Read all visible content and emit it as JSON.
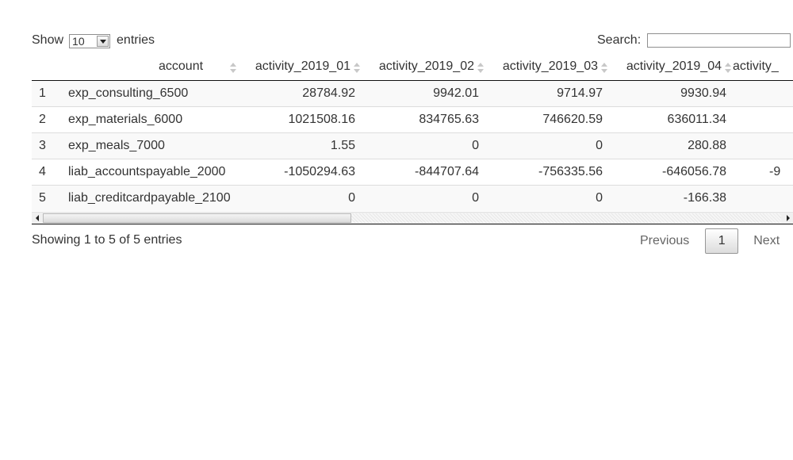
{
  "length_control": {
    "prefix": "Show",
    "selected": "10",
    "suffix": "entries"
  },
  "search": {
    "label": "Search:",
    "value": ""
  },
  "table": {
    "headers": {
      "account": "account",
      "col1": "activity_2019_01",
      "col2": "activity_2019_02",
      "col3": "activity_2019_03",
      "col4": "activity_2019_04",
      "col5": "activity_"
    },
    "rows": [
      {
        "idx": "1",
        "account": "exp_consulting_6500",
        "v1": "28784.92",
        "v2": "9942.01",
        "v3": "9714.97",
        "v4": "9930.94",
        "v5": ""
      },
      {
        "idx": "2",
        "account": "exp_materials_6000",
        "v1": "1021508.16",
        "v2": "834765.63",
        "v3": "746620.59",
        "v4": "636011.34",
        "v5": ""
      },
      {
        "idx": "3",
        "account": "exp_meals_7000",
        "v1": "1.55",
        "v2": "0",
        "v3": "0",
        "v4": "280.88",
        "v5": ""
      },
      {
        "idx": "4",
        "account": "liab_accountspayable_2000",
        "v1": "-1050294.63",
        "v2": "-844707.64",
        "v3": "-756335.56",
        "v4": "-646056.78",
        "v5": "-9"
      },
      {
        "idx": "5",
        "account": "liab_creditcardpayable_2100",
        "v1": "0",
        "v2": "0",
        "v3": "0",
        "v4": "-166.38",
        "v5": ""
      }
    ]
  },
  "info": "Showing 1 to 5 of 5 entries",
  "pagination": {
    "previous": "Previous",
    "current": "1",
    "next": "Next"
  }
}
